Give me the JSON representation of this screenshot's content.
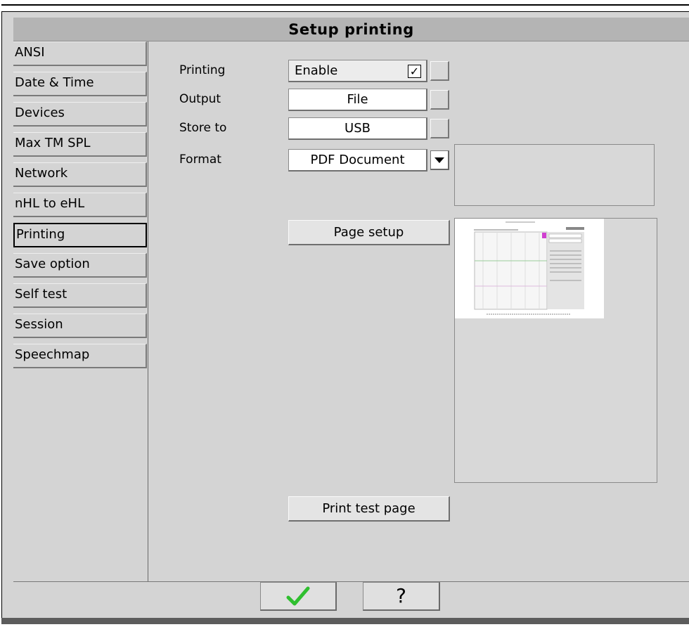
{
  "window": {
    "title": "Setup printing"
  },
  "sidebar": {
    "items": [
      {
        "label": "ANSI"
      },
      {
        "label": "Date & Time"
      },
      {
        "label": "Devices"
      },
      {
        "label": "Max TM SPL"
      },
      {
        "label": "Network"
      },
      {
        "label": "nHL to eHL"
      },
      {
        "label": "Printing",
        "selected": true
      },
      {
        "label": "Save option"
      },
      {
        "label": "Self test"
      },
      {
        "label": "Session"
      },
      {
        "label": "Speechmap"
      }
    ]
  },
  "form": {
    "printing": {
      "label": "Printing",
      "value": "Enable",
      "checked": true,
      "check_glyph": "✓"
    },
    "output": {
      "label": "Output",
      "value": "File"
    },
    "store_to": {
      "label": "Store to",
      "value": "USB"
    },
    "format": {
      "label": "Format",
      "value": "PDF Document"
    }
  },
  "buttons": {
    "page_setup": "Page setup",
    "print_test_page": "Print test page"
  },
  "footer": {
    "ok_icon": "green-checkmark-icon",
    "help_label": "?"
  },
  "colors": {
    "background": "#d4d4d4",
    "title_bar": "#b4b4b4",
    "ok_check": "#2fbf2f",
    "preview_marker": "#d040d0"
  }
}
